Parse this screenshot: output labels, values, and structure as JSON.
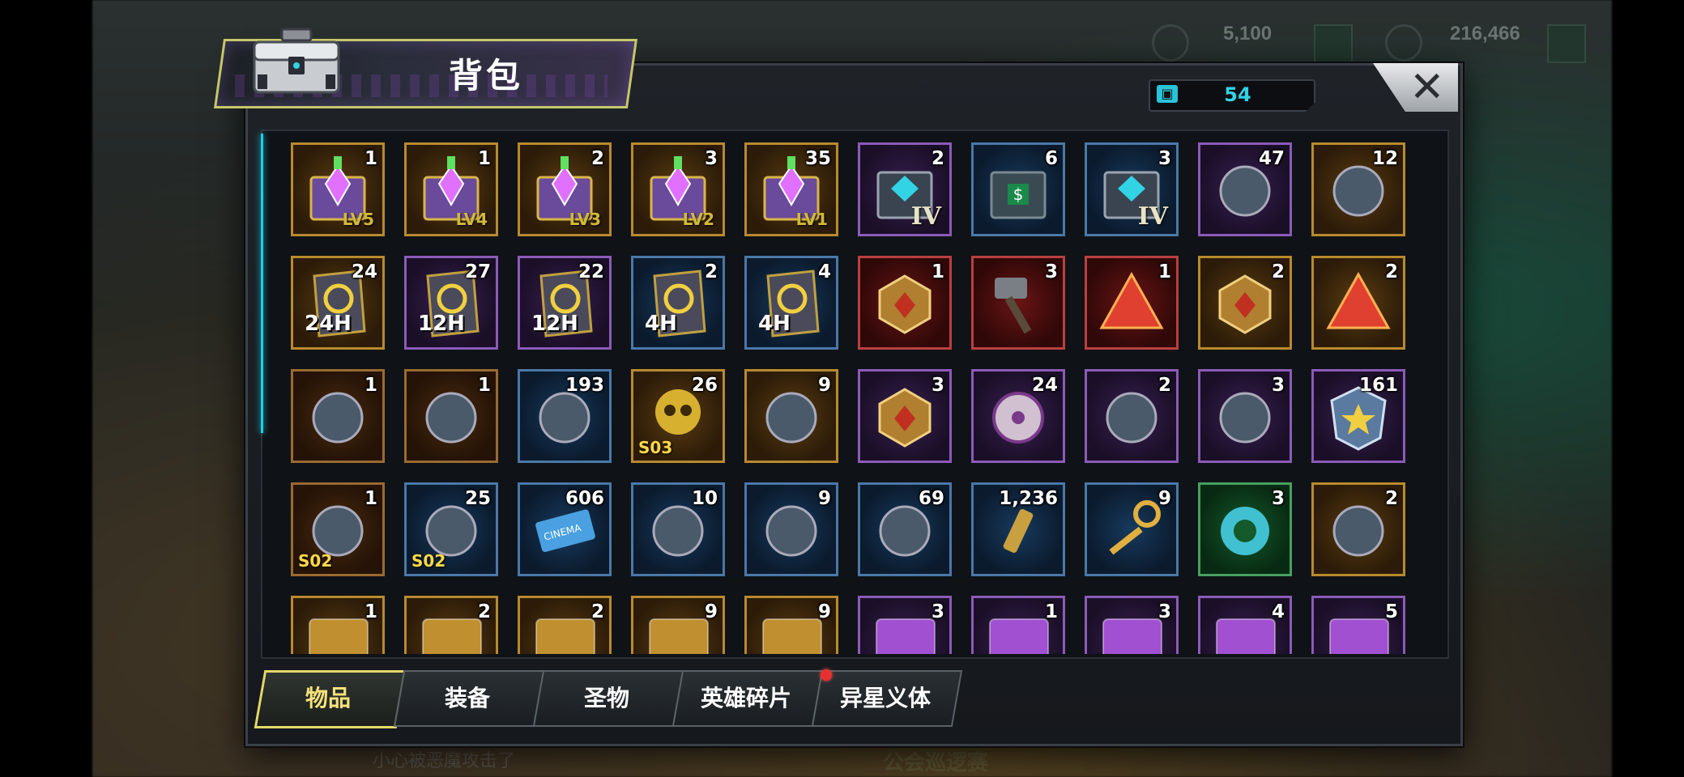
{
  "hud": {
    "currency_1": "5,100",
    "currency_2": "216,466",
    "bottom_banner": "公会巡逻赛",
    "bottom_hint": "小心被恶魔攻击了"
  },
  "window": {
    "title": "背包",
    "close_label": "✕",
    "capacity_icon": "bag-icon",
    "capacity_value": "54"
  },
  "items": [
    [
      {
        "qty": "1",
        "rarity": "gold",
        "icon": "supply-chest-lv5-icon",
        "lvl": "LV5"
      },
      {
        "qty": "1",
        "rarity": "gold",
        "icon": "supply-chest-lv4-icon",
        "lvl": "LV4"
      },
      {
        "qty": "2",
        "rarity": "gold",
        "icon": "supply-chest-lv3-icon",
        "lvl": "LV3"
      },
      {
        "qty": "3",
        "rarity": "gold",
        "icon": "supply-chest-lv2-icon",
        "lvl": "LV2"
      },
      {
        "qty": "35",
        "rarity": "gold",
        "icon": "supply-chest-lv1-icon",
        "lvl": "LV1"
      },
      {
        "qty": "2",
        "rarity": "purple",
        "icon": "tier-iv-chest-purple-icon",
        "roman": "IV"
      },
      {
        "qty": "6",
        "rarity": "blue",
        "icon": "cash-chest-icon"
      },
      {
        "qty": "3",
        "rarity": "blue",
        "icon": "tier-iv-chest-blue-icon",
        "roman": "IV"
      },
      {
        "qty": "47",
        "rarity": "purple",
        "icon": "gene-device-icon"
      },
      {
        "qty": "12",
        "rarity": "gold",
        "icon": "gold-crate-icon"
      }
    ],
    [
      {
        "qty": "24",
        "rarity": "gold",
        "icon": "speedup-card-gold-icon",
        "hours": "24H"
      },
      {
        "qty": "27",
        "rarity": "purple",
        "icon": "speedup-card-purple-icon",
        "hours": "12H"
      },
      {
        "qty": "22",
        "rarity": "purple",
        "icon": "speedup-card-purple-icon",
        "hours": "12H"
      },
      {
        "qty": "2",
        "rarity": "blue",
        "icon": "speedup-card-blue-icon",
        "hours": "4H"
      },
      {
        "qty": "4",
        "rarity": "blue",
        "icon": "speedup-card-blue-icon",
        "hours": "4H"
      },
      {
        "qty": "1",
        "rarity": "red",
        "icon": "gold-cube-icon"
      },
      {
        "qty": "3",
        "rarity": "red",
        "icon": "war-hammer-icon"
      },
      {
        "qty": "1",
        "rarity": "red",
        "icon": "red-pyramid-icon"
      },
      {
        "qty": "2",
        "rarity": "gold",
        "icon": "silver-cube-icon"
      },
      {
        "qty": "2",
        "rarity": "gold",
        "icon": "gold-shard-icon"
      }
    ],
    [
      {
        "qty": "1",
        "rarity": "brown",
        "icon": "green-token-icon"
      },
      {
        "qty": "1",
        "rarity": "brown",
        "icon": "red-spiral-token-icon"
      },
      {
        "qty": "193",
        "rarity": "blue",
        "icon": "lips-badge-icon"
      },
      {
        "qty": "26",
        "rarity": "gold",
        "icon": "golden-skull-icon",
        "tag": "S03"
      },
      {
        "qty": "9",
        "rarity": "gold",
        "icon": "bunny-doll-icon"
      },
      {
        "qty": "3",
        "rarity": "purple",
        "icon": "purple-cube-icon"
      },
      {
        "qty": "24",
        "rarity": "purple",
        "icon": "film-reel-icon"
      },
      {
        "qty": "2",
        "rarity": "purple",
        "icon": "pink-cap-icon"
      },
      {
        "qty": "3",
        "rarity": "purple",
        "icon": "poker-chip-spade-icon"
      },
      {
        "qty": "161",
        "rarity": "purple",
        "icon": "police-badge-icon"
      }
    ],
    [
      {
        "qty": "1",
        "rarity": "brown",
        "icon": "tarot-cards-icon",
        "tag": "S02"
      },
      {
        "qty": "25",
        "rarity": "blue",
        "icon": "cocktail-icon",
        "tag": "S02"
      },
      {
        "qty": "606",
        "rarity": "blue",
        "icon": "cinema-ticket-icon"
      },
      {
        "qty": "10",
        "rarity": "blue",
        "icon": "timer-token-icon"
      },
      {
        "qty": "9",
        "rarity": "blue",
        "icon": "bottle-cap-b-icon"
      },
      {
        "qty": "69",
        "rarity": "blue",
        "icon": "casino-chip-icon"
      },
      {
        "qty": "1,236",
        "rarity": "blue",
        "icon": "bullet-icon"
      },
      {
        "qty": "9",
        "rarity": "blue",
        "icon": "golden-key-icon"
      },
      {
        "qty": "3",
        "rarity": "green",
        "icon": "swim-ring-icon"
      },
      {
        "qty": "2",
        "rarity": "gold",
        "icon": "cowboy-hat-blueprint-icon"
      }
    ],
    [
      {
        "qty": "1",
        "rarity": "gold",
        "icon": "blueprint-gold-icon"
      },
      {
        "qty": "2",
        "rarity": "gold",
        "icon": "blueprint-gold-icon"
      },
      {
        "qty": "2",
        "rarity": "gold",
        "icon": "blueprint-gold-icon"
      },
      {
        "qty": "9",
        "rarity": "gold",
        "icon": "blueprint-gold-icon"
      },
      {
        "qty": "9",
        "rarity": "gold",
        "icon": "blueprint-gold-icon"
      },
      {
        "qty": "3",
        "rarity": "purple",
        "icon": "blueprint-purple-icon"
      },
      {
        "qty": "1",
        "rarity": "purple",
        "icon": "blueprint-purple-icon"
      },
      {
        "qty": "3",
        "rarity": "purple",
        "icon": "blueprint-purple-icon"
      },
      {
        "qty": "4",
        "rarity": "purple",
        "icon": "blueprint-purple-icon"
      },
      {
        "qty": "5",
        "rarity": "purple",
        "icon": "blueprint-purple-icon"
      }
    ]
  ],
  "tabs": [
    {
      "label": "物品",
      "active": true
    },
    {
      "label": "装备",
      "active": false
    },
    {
      "label": "圣物",
      "active": false
    },
    {
      "label": "英雄碎片",
      "active": false,
      "badge": true
    },
    {
      "label": "异星义体",
      "active": false
    }
  ],
  "colors": {
    "accent_cyan": "#31d3e5",
    "active_tab_border": "#e2d86a",
    "notification_dot": "#e83030"
  }
}
